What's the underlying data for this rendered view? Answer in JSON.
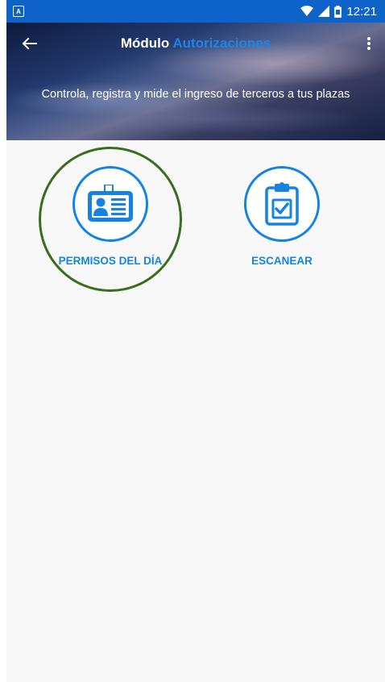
{
  "status_bar": {
    "time": "12:21",
    "notification_icon": "a-icon",
    "wifi_icon": "wifi-icon",
    "signal_icon": "signal-icon",
    "battery_icon": "battery-icon",
    "bg_color": "#0d63c9"
  },
  "header": {
    "title_main": "Módulo",
    "title_accent": "Autorizaciones",
    "subtitle": "Controla, registra y mide el ingreso de terceros a tus plazas",
    "back_icon": "arrow-left-icon",
    "menu_icon": "more-vert-icon"
  },
  "tiles": [
    {
      "label": "PERMISOS DEL DÍA",
      "icon": "id-card-icon"
    },
    {
      "label": "ESCANEAR",
      "icon": "clipboard-check-icon"
    }
  ],
  "colors": {
    "accent": "#1584e0",
    "highlight_ring": "#3a6e1f",
    "background": "#f8f8f8"
  }
}
